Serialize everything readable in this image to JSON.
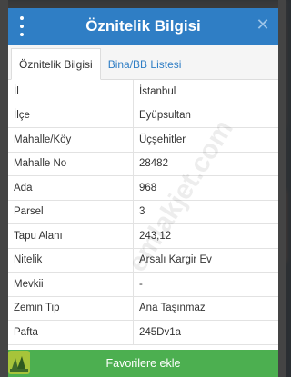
{
  "dialog": {
    "title": "Öznitelik Bilgisi",
    "tabs": [
      {
        "label": "Öznitelik Bilgisi",
        "active": true
      },
      {
        "label": "Bina/BB Listesi",
        "active": false
      }
    ],
    "rows": [
      {
        "key": "İl",
        "value": "İstanbul"
      },
      {
        "key": "İlçe",
        "value": "Eyüpsultan"
      },
      {
        "key": "Mahalle/Köy",
        "value": "Üçşehitler"
      },
      {
        "key": "Mahalle No",
        "value": "28482"
      },
      {
        "key": "Ada",
        "value": "968"
      },
      {
        "key": "Parsel",
        "value": "3"
      },
      {
        "key": "Tapu Alanı",
        "value": "243,12"
      },
      {
        "key": "Nitelik",
        "value": "Arsalı Kargir Ev"
      },
      {
        "key": "Mevkii",
        "value": "-"
      },
      {
        "key": "Zemin Tip",
        "value": "Ana Taşınmaz"
      },
      {
        "key": "Pafta",
        "value": "245Dv1a"
      }
    ],
    "favorite_button": "Favorilere ekle",
    "watermark": "emlakjet.com"
  },
  "colors": {
    "header": "#2f7ec5",
    "favorite": "#4caf50",
    "tab_link": "#2f7ec5"
  },
  "icons": {
    "menu": "kebab-menu-icon",
    "close": "close-icon",
    "corner": "app-logo-icon"
  }
}
